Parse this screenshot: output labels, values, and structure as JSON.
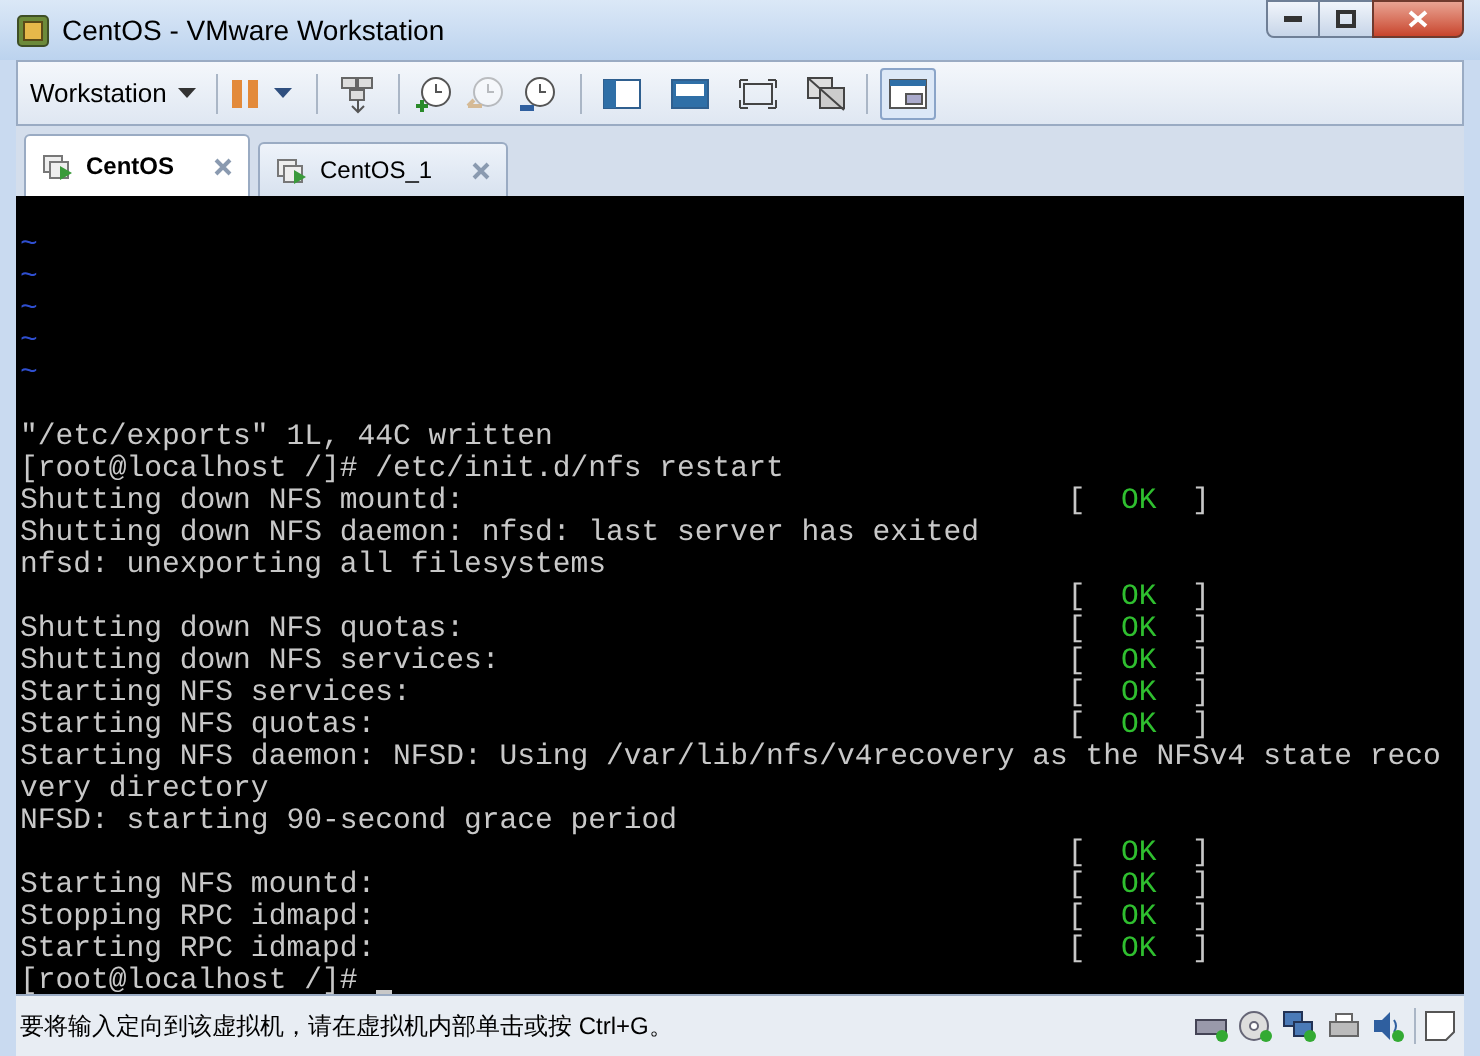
{
  "window": {
    "title": "CentOS - VMware Workstation"
  },
  "toolbar": {
    "menu_label": "Workstation"
  },
  "tabs": [
    {
      "label": "CentOS",
      "selected": true
    },
    {
      "label": "CentOS_1",
      "selected": false
    }
  ],
  "console": {
    "lines": [
      {
        "kind": "blank"
      },
      {
        "kind": "tilde",
        "text": "~"
      },
      {
        "kind": "tilde",
        "text": "~"
      },
      {
        "kind": "tilde",
        "text": "~"
      },
      {
        "kind": "tilde",
        "text": "~"
      },
      {
        "kind": "tilde",
        "text": "~"
      },
      {
        "kind": "blank"
      },
      {
        "kind": "text",
        "text": "\"/etc/exports\" 1L, 44C written"
      },
      {
        "kind": "text",
        "text": "[root@localhost /]# /etc/init.d/nfs restart"
      },
      {
        "kind": "text",
        "text": "Shutting down NFS mountd:",
        "status": [
          "[",
          "OK",
          "]"
        ]
      },
      {
        "kind": "text",
        "text": "Shutting down NFS daemon: nfsd: last server has exited"
      },
      {
        "kind": "text",
        "text": "nfsd: unexporting all filesystems"
      },
      {
        "kind": "text",
        "status": [
          "[",
          "OK",
          "]"
        ]
      },
      {
        "kind": "text",
        "text": "Shutting down NFS quotas:",
        "status": [
          "[",
          "OK",
          "]"
        ]
      },
      {
        "kind": "text",
        "text": "Shutting down NFS services:",
        "status": [
          "[",
          "OK",
          "]"
        ]
      },
      {
        "kind": "text",
        "text": "Starting NFS services:",
        "status": [
          "[",
          "OK",
          "]"
        ]
      },
      {
        "kind": "text",
        "text": "Starting NFS quotas:",
        "status": [
          "[",
          "OK",
          "]"
        ]
      },
      {
        "kind": "text",
        "text": "Starting NFS daemon: NFSD: Using /var/lib/nfs/v4recovery as the NFSv4 state reco"
      },
      {
        "kind": "text",
        "text": "very directory"
      },
      {
        "kind": "text",
        "text": "NFSD: starting 90-second grace period"
      },
      {
        "kind": "text",
        "status": [
          "[",
          "OK",
          "]"
        ]
      },
      {
        "kind": "text",
        "text": "Starting NFS mountd:",
        "status": [
          "[",
          "OK",
          "]"
        ]
      },
      {
        "kind": "text",
        "text": "Stopping RPC idmapd:",
        "status": [
          "[",
          "OK",
          "]"
        ]
      },
      {
        "kind": "text",
        "text": "Starting RPC idmapd:",
        "status": [
          "[",
          "OK",
          "]"
        ]
      },
      {
        "kind": "prompt",
        "text": "[root@localhost /]# "
      }
    ]
  },
  "status_bar": {
    "message": "要将输入定向到该虚拟机，请在虚拟机内部单击或按 Ctrl+G。"
  }
}
